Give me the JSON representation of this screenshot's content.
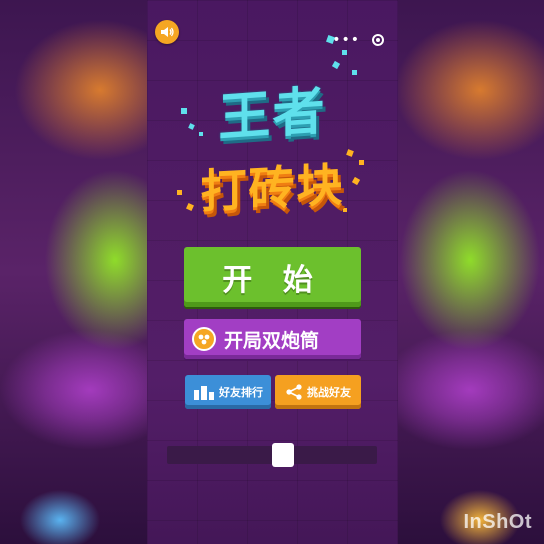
{
  "game": {
    "title_line1": "王者",
    "title_line2": "打砖块"
  },
  "menu": {
    "start_label": "开 始",
    "cannon_label": "开局双炮筒",
    "rank_label": "好友排行",
    "challenge_label": "挑战好友"
  },
  "capsule": {
    "more_glyph": "•••"
  },
  "slider": {
    "position_fraction": 0.55
  },
  "watermark": {
    "text": "InShOt"
  },
  "colors": {
    "start_green": "#6cc02d",
    "cannon_purple": "#a23ec4",
    "rank_blue": "#3c8fd8",
    "challenge_orange": "#f5a020",
    "title_cyan": "#5fe0ec",
    "title_orange": "#ffb321"
  },
  "icons": {
    "sound": "speaker-icon",
    "more": "more-dots-icon",
    "target": "target-icon",
    "coin": "coin-icon",
    "rank": "bar-chart-icon",
    "share": "share-icon"
  }
}
